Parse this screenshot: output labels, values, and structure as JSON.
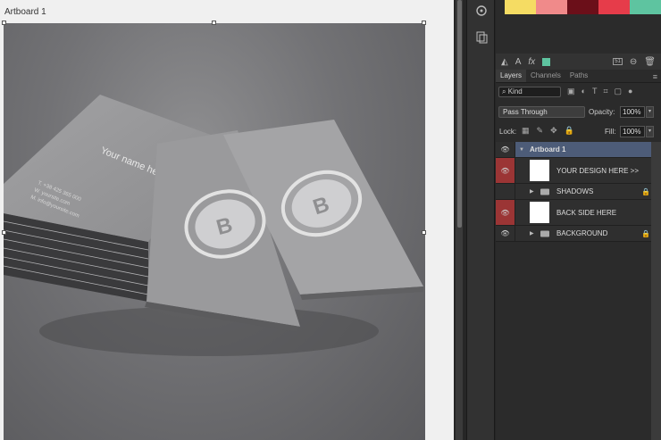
{
  "artboard": {
    "label": "Artboard 1"
  },
  "cards": {
    "name_text": "Your name here",
    "info_lines": [
      "T. +38 425 365 000",
      "W. yoursite.com",
      "M. info@yoursite.com"
    ],
    "logo_letter": "B"
  },
  "swatches": [
    "#f5dc63",
    "#f08a8a",
    "#6b0f19",
    "#e63c4a",
    "#5ec4a0"
  ],
  "layers_panel": {
    "tabs": [
      "Layers",
      "Channels",
      "Paths"
    ],
    "filter_kind": "Kind",
    "blend_mode": "Pass Through",
    "opacity_label": "Opacity:",
    "opacity_value": "100%",
    "lock_label": "Lock:",
    "fill_label": "Fill:",
    "fill_value": "100%",
    "layers": [
      {
        "name": "Artboard 1"
      },
      {
        "name": "YOUR DESIGN HERE >>"
      },
      {
        "name": "SHADOWS"
      },
      {
        "name": "BACK SIDE HERE"
      },
      {
        "name": "BACKGROUND"
      }
    ]
  },
  "colors": {
    "accent_selected": "#4d5c78",
    "eye_highlight": "#9b3535"
  }
}
